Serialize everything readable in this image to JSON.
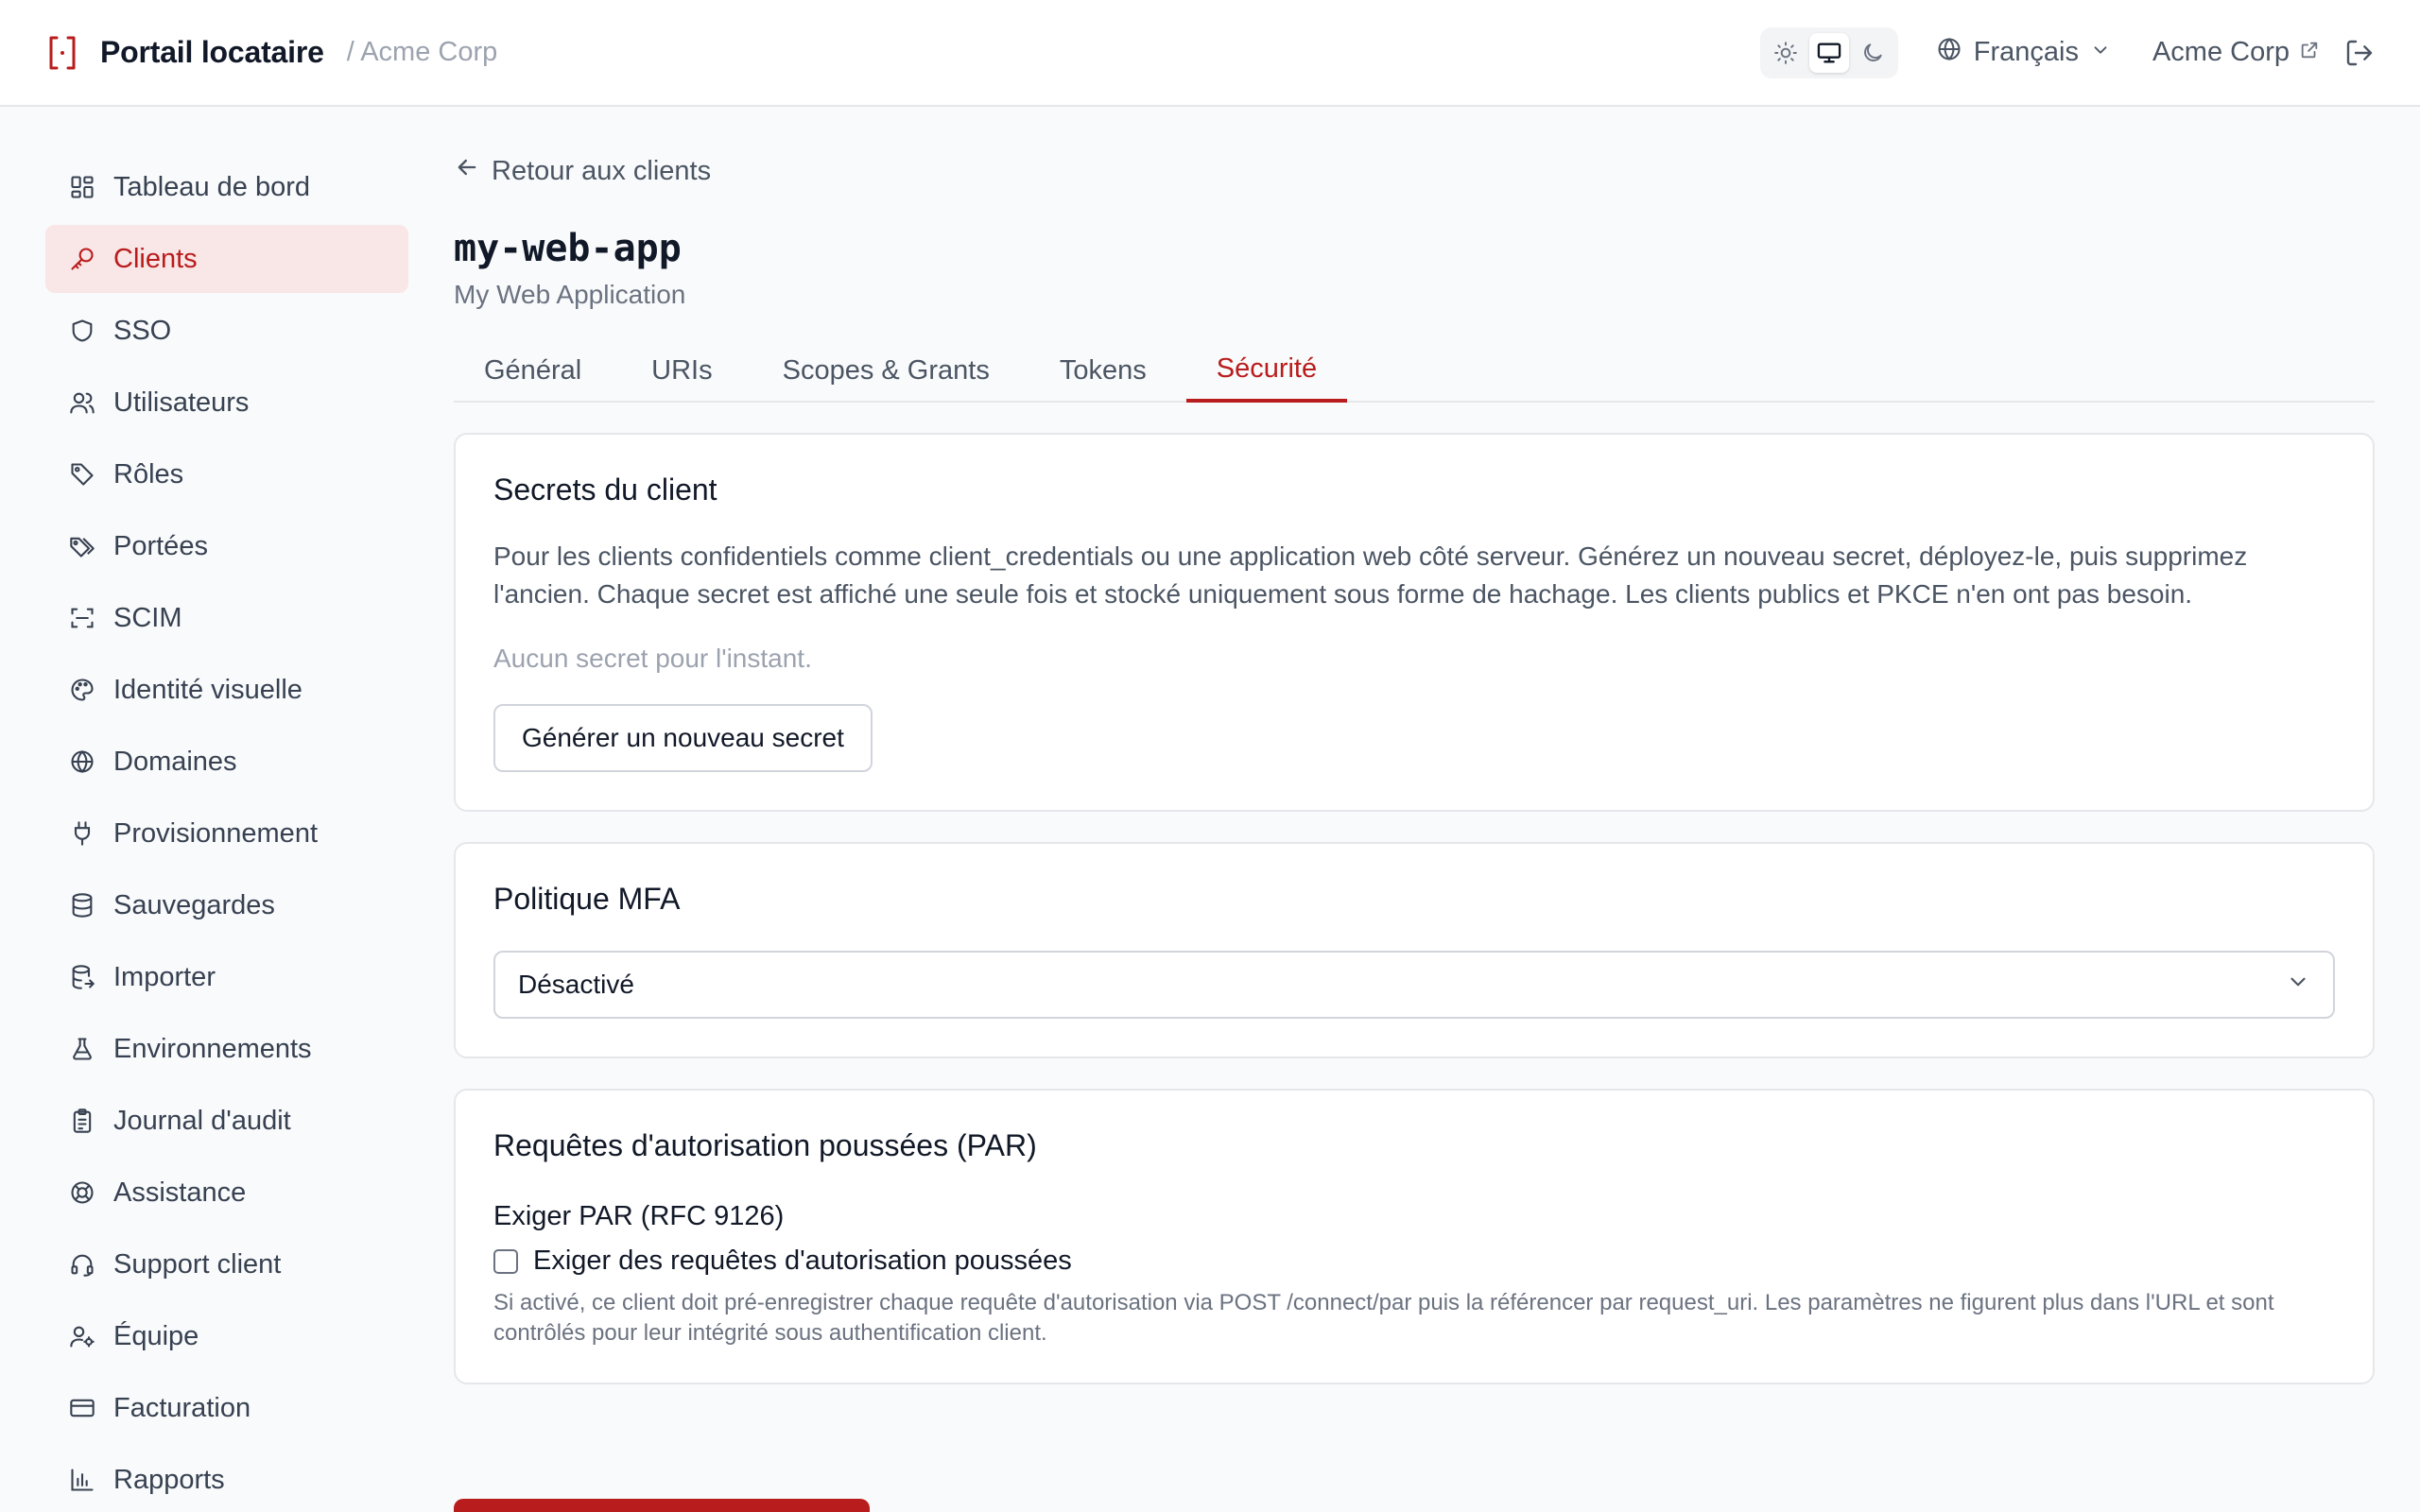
{
  "header": {
    "title": "Portail locataire",
    "org": "/ Acme Corp",
    "theme_modes": [
      "light-icon",
      "system-icon",
      "dark-icon"
    ],
    "active_theme": "system",
    "language": "Français",
    "org_link": "Acme Corp"
  },
  "sidebar": {
    "items": [
      {
        "label": "Tableau de bord",
        "icon": "dashboard-icon"
      },
      {
        "label": "Clients",
        "icon": "key-icon",
        "active": true
      },
      {
        "label": "SSO",
        "icon": "shield-icon"
      },
      {
        "label": "Utilisateurs",
        "icon": "users-icon"
      },
      {
        "label": "Rôles",
        "icon": "tag-icon"
      },
      {
        "label": "Portées",
        "icon": "tags-icon"
      },
      {
        "label": "SCIM",
        "icon": "scan-icon"
      },
      {
        "label": "Identité visuelle",
        "icon": "palette-icon"
      },
      {
        "label": "Domaines",
        "icon": "globe-icon"
      },
      {
        "label": "Provisionnement",
        "icon": "plug-icon"
      },
      {
        "label": "Sauvegardes",
        "icon": "database-icon"
      },
      {
        "label": "Importer",
        "icon": "database-import-icon"
      },
      {
        "label": "Environnements",
        "icon": "flask-icon"
      },
      {
        "label": "Journal d'audit",
        "icon": "clipboard-icon"
      },
      {
        "label": "Assistance",
        "icon": "lifebuoy-icon"
      },
      {
        "label": "Support client",
        "icon": "headset-icon"
      },
      {
        "label": "Équipe",
        "icon": "user-gear-icon"
      },
      {
        "label": "Facturation",
        "icon": "credit-card-icon"
      },
      {
        "label": "Rapports",
        "icon": "bar-chart-icon"
      }
    ]
  },
  "main": {
    "back_label": "Retour aux clients",
    "app_title": "my-web-app",
    "app_subtitle": "My Web Application",
    "tabs": [
      {
        "label": "Général"
      },
      {
        "label": "URIs"
      },
      {
        "label": "Scopes & Grants"
      },
      {
        "label": "Tokens"
      },
      {
        "label": "Sécurité",
        "active": true
      }
    ],
    "secrets": {
      "title": "Secrets du client",
      "description": "Pour les clients confidentiels comme client_credentials ou une application web côté serveur. Générez un nouveau secret, déployez-le, puis supprimez l'ancien. Chaque secret est affiché une seule fois et stocké uniquement sous forme de hachage. Les clients publics et PKCE n'en ont pas besoin.",
      "empty": "Aucun secret pour l'instant.",
      "button": "Générer un nouveau secret"
    },
    "mfa": {
      "title": "Politique MFA",
      "selected": "Désactivé"
    },
    "par": {
      "title": "Requêtes d'autorisation poussées (PAR)",
      "field_label": "Exiger PAR (RFC 9126)",
      "checkbox_label": "Exiger des requêtes d'autorisation poussées",
      "checked": false,
      "help": "Si activé, ce client doit pré-enregistrer chaque requête d'autorisation via POST /connect/par puis la référencer par request_uri. Les paramètres ne figurent plus dans l'URL et sont contrôlés pour leur intégrité sous authentification client."
    }
  },
  "colors": {
    "accent": "#b91c1c",
    "accent_bg": "#f9e6e6"
  }
}
